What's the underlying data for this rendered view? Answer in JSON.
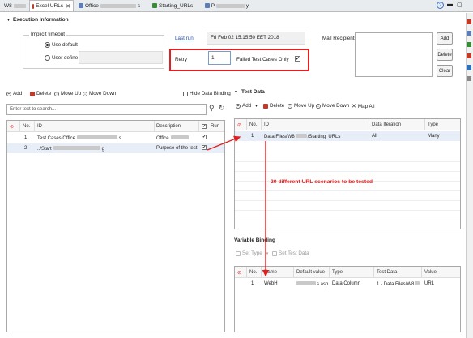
{
  "tabs": [
    {
      "label": "W8",
      "active": false
    },
    {
      "label": "Excel URLs",
      "active": true
    },
    {
      "label": "Office",
      "active": false
    },
    {
      "label": "s",
      "active": false
    },
    {
      "label": "Starting_URLs",
      "active": false
    },
    {
      "label": "P",
      "active": false
    },
    {
      "label": "y",
      "active": false
    }
  ],
  "execution": {
    "section_title": "Execution Information",
    "timeout_label": "Implicit timeout",
    "use_default": "Use default",
    "user_define": "User define",
    "last_run_label": "Last run",
    "last_run_value": "Fri Feb 02 15:15:50 EET 2018",
    "retry_label": "Retry",
    "retry_value": "1",
    "failed_only_label": "Failed Test Cases Only",
    "mail_label": "Mail Recipients",
    "mail_buttons": [
      "Add",
      "Delete",
      "Clear"
    ]
  },
  "left_toolbar": {
    "add": "Add",
    "delete": "Delete",
    "move_up": "Move Up",
    "move_down": "Move Down",
    "hide_binding": "Hide Data Binding",
    "search_placeholder": "Enter text to search..."
  },
  "test_cases": {
    "headers": [
      "No.",
      "ID",
      "Description",
      "Run"
    ],
    "rows": [
      {
        "no": "1",
        "id": "Test Cases/Office",
        "id_suffix": "s",
        "desc": "Office"
      },
      {
        "no": "2",
        "id": "../Start",
        "id_suffix": "g",
        "desc": "Purpose of the test"
      }
    ]
  },
  "test_data": {
    "section_title": "Test Data",
    "toolbar": [
      "Add",
      "Delete",
      "Move Up",
      "Move Down",
      "Map All"
    ],
    "headers": [
      "No.",
      "ID",
      "Data Iteration",
      "Type"
    ],
    "rows": [
      {
        "no": "1",
        "id_prefix": "Data Files/W8",
        "id_suffix": "/Starting_URLs",
        "iteration": "All",
        "type": "Many"
      }
    ]
  },
  "annotation": "20 different URL scenarios to be tested",
  "variable_binding": {
    "section_title": "Variable Binding",
    "toolbar": [
      "Set Type",
      "Set Test Data"
    ],
    "headers": [
      "No.",
      "Name",
      "Default value",
      "Type",
      "Test Data",
      "Value"
    ],
    "rows": [
      {
        "no": "1",
        "name": "WebH",
        "default_suffix": "s.asp",
        "type": "Data Column",
        "test_data": "1 - Data Files/W8",
        "value": "URL"
      }
    ]
  },
  "colors": {
    "highlight": "#e02020",
    "arrow": "#e02020",
    "link": "#1f4fb3",
    "annotation": "#e02020"
  }
}
